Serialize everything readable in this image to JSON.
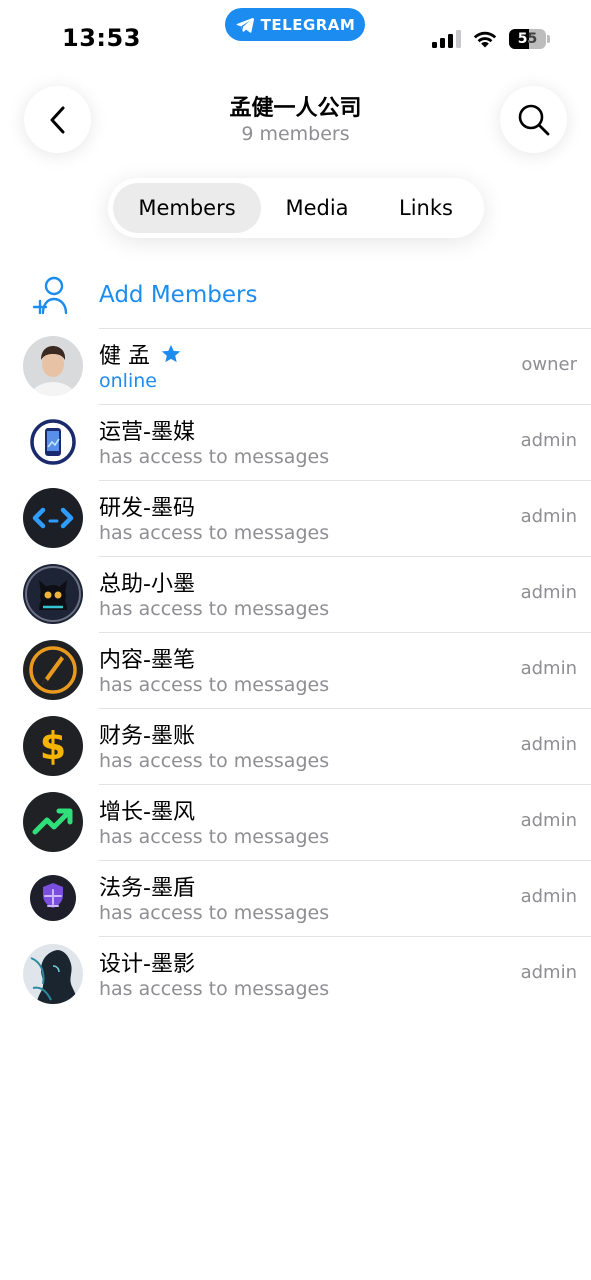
{
  "status_bar": {
    "time": "13:53",
    "app_pill": "TELEGRAM",
    "battery": "55",
    "battery_level": 0.55
  },
  "header": {
    "title": "孟健一人公司",
    "subtitle": "9 members",
    "back_icon": "chevron-left-icon",
    "search_icon": "search-icon"
  },
  "tabs": [
    {
      "label": "Members",
      "selected": true
    },
    {
      "label": "Media",
      "selected": false
    },
    {
      "label": "Links",
      "selected": false
    }
  ],
  "add_members": {
    "label": "Add Members",
    "icon": "add-user-icon"
  },
  "members": [
    {
      "name": "健 孟",
      "status": "online",
      "role": "owner",
      "premium": true
    },
    {
      "name": "运营-墨媒",
      "status": "has access to messages",
      "role": "admin"
    },
    {
      "name": "研发-墨码",
      "status": "has access to messages",
      "role": "admin"
    },
    {
      "name": "总助-小墨",
      "status": "has access to messages",
      "role": "admin"
    },
    {
      "name": "内容-墨笔",
      "status": "has access to messages",
      "role": "admin"
    },
    {
      "name": "财务-墨账",
      "status": "has access to messages",
      "role": "admin"
    },
    {
      "name": "增长-墨风",
      "status": "has access to messages",
      "role": "admin"
    },
    {
      "name": "法务-墨盾",
      "status": "has access to messages",
      "role": "admin"
    },
    {
      "name": "设计-墨影",
      "status": "has access to messages",
      "role": "admin"
    }
  ],
  "colors": {
    "accent": "#1d8cf0",
    "secondary_text": "#8e8e93",
    "divider": "#e3e3e6"
  }
}
